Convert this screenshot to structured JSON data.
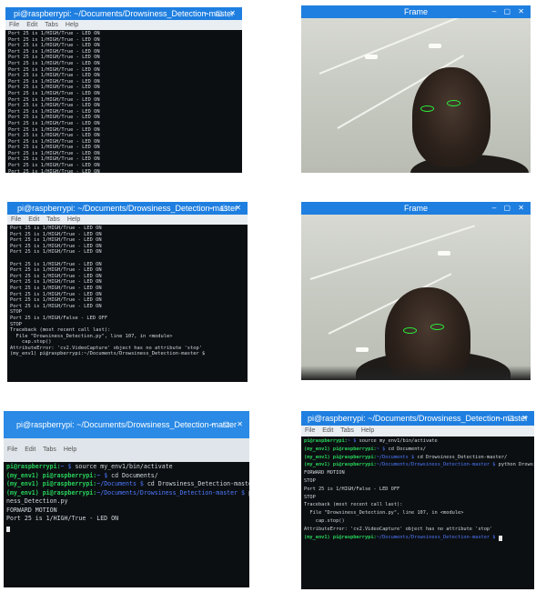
{
  "panels": {
    "p1": {
      "title": "pi@raspberrypi: ~/Documents/Drowsiness_Detection-master",
      "menu": [
        "File",
        "Edit",
        "Tabs",
        "Help"
      ],
      "lines": [
        "Port 25 is 1/HIGH/True - LED ON",
        "Port 25 is 1/HIGH/True - LED ON",
        "Port 25 is 1/HIGH/True - LED ON",
        "Port 25 is 1/HIGH/True - LED ON",
        "Port 25 is 1/HIGH/True - LED ON",
        "Port 25 is 1/HIGH/True - LED ON",
        "Port 25 is 1/HIGH/True - LED ON",
        "Port 25 is 1/HIGH/True - LED ON",
        "Port 25 is 1/HIGH/True - LED ON",
        "Port 25 is 1/HIGH/True - LED ON",
        "Port 25 is 1/HIGH/True - LED ON",
        "Port 25 is 1/HIGH/True - LED ON",
        "Port 25 is 1/HIGH/True - LED ON",
        "Port 25 is 1/HIGH/True - LED ON",
        "Port 25 is 1/HIGH/True - LED ON",
        "Port 25 is 1/HIGH/True - LED ON",
        "Port 25 is 1/HIGH/True - LED ON",
        "Port 25 is 1/HIGH/True - LED ON",
        "Port 25 is 1/HIGH/True - LED ON",
        "Port 25 is 1/HIGH/True - LED ON",
        "Port 25 is 1/HIGH/True - LED ON",
        "Port 25 is 1/HIGH/True - LED ON",
        "Port 25 is 1/HIGH/True - LED ON",
        "Port 25 is 1/HIGH/True - LED ON"
      ]
    },
    "p2": {
      "title": "Frame",
      "controls": "– ▢ ✕"
    },
    "p3": {
      "title": "pi@raspberrypi: ~/Documents/Drowsiness_Detection-master",
      "menu": [
        "File",
        "Edit",
        "Tabs",
        "Help"
      ],
      "lines": [
        "Port 25 is 1/HIGH/True - LED ON",
        "Port 25 is 1/HIGH/True - LED ON",
        "Port 25 is 1/HIGH/True - LED ON",
        "Port 25 is 1/HIGH/True - LED ON",
        "Port 25 is 1/HIGH/True - LED ON",
        "",
        "Port 25 is 1/HIGH/True - LED ON",
        "Port 25 is 1/HIGH/True - LED ON",
        "Port 25 is 1/HIGH/True - LED ON",
        "Port 25 is 1/HIGH/True - LED ON",
        "Port 25 is 1/HIGH/True - LED ON",
        "Port 25 is 1/HIGH/True - LED ON",
        "Port 25 is 1/HIGH/True - LED ON",
        "Port 25 is 1/HIGH/True - LED ON",
        "STOP",
        "Port 25 is 1/HIGH/False - LED OFF",
        "STOP",
        "Traceback (most recent call last):",
        "  File \"Drowsiness_Detection.py\", line 107, in <module>",
        "    cap.stop()",
        "AttributeError: 'cv2.VideoCapture' object has no attribute 'stop'",
        "(my_env1) pi@raspberrypi:~/Documents/Drowsiness_Detection-master $"
      ]
    },
    "p4": {
      "title": "Frame",
      "controls": "– ▢ ✕"
    },
    "p5": {
      "title": "pi@raspberrypi: ~/Documents/Drowsiness_Detection-master",
      "menu": [
        "File",
        "Edit",
        "Tabs",
        "Help"
      ],
      "lines": [
        [
          "pi@raspberrypi:",
          "~ $",
          " source my_env1/bin/activate"
        ],
        [
          "(my_env1) pi@raspberrypi:",
          "~ $",
          " cd Documents/"
        ],
        [
          "(my_env1) pi@raspberrypi:",
          "~/Documents $",
          " cd Drowsiness_Detection-master/"
        ],
        [
          "(my_env1) pi@raspberrypi:",
          "~/Documents/Drowsiness_Detection-master $",
          " python Drowsiness_Detection.py"
        ],
        [
          "",
          "",
          "ness_Detection.py"
        ],
        [
          "",
          "",
          "FORWARD MOTION"
        ],
        [
          "",
          "",
          "Port 25 is 1/HIGH/True - LED ON"
        ]
      ]
    },
    "p6": {
      "title": "pi@raspberrypi: ~/Documents/Drowsiness_Detection-master",
      "menu": [
        "File",
        "Edit",
        "Tabs",
        "Help"
      ],
      "lines": [
        [
          "pi@raspberrypi:",
          "~ $",
          " source my_env1/bin/activate"
        ],
        [
          "(my_env1) pi@raspberrypi:",
          "~ $",
          " cd Documents/"
        ],
        [
          "(my_env1) pi@raspberrypi:",
          "~/Documents $",
          " cd Drowsiness_Detection-master/"
        ],
        [
          "(my_env1) pi@raspberrypi:",
          "~/Documents/Drowsiness_Detection-master $",
          " python Drowsiness_Detection.py"
        ],
        [
          "",
          "",
          "FORWARD MOTION"
        ],
        [
          "",
          "",
          "STOP"
        ],
        [
          "",
          "",
          "Port 25 is 1/HIGH/False - LED OFF"
        ],
        [
          "",
          "",
          "STOP"
        ],
        [
          "",
          "",
          "Traceback (most recent call last):"
        ],
        [
          "",
          "",
          "  File \"Drowsiness_Detection.py\", line 107, in <module>"
        ],
        [
          "",
          "",
          "    cap.stop()"
        ],
        [
          "",
          "",
          "AttributeError: 'cv2.VideoCapture' object has no attribute 'stop'"
        ],
        [
          "(my_env1) pi@raspberrypi:",
          "~/Documents/Drowsiness_Detection-master $",
          ""
        ]
      ]
    }
  },
  "colors": {
    "titlebar": "#1f7fe0",
    "prompt": "#27d35a",
    "path": "#4d79ff",
    "eye_contour": "#2bf03a"
  }
}
